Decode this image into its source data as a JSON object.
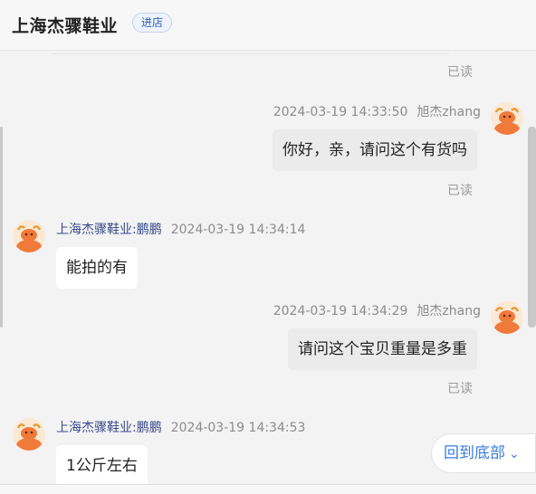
{
  "header": {
    "shop_name": "上海杰骤鞋业",
    "enter_shop": "进店"
  },
  "messages": [
    {
      "read": "已读"
    },
    {
      "time": "2024-03-19 14:33:50",
      "sender": "旭杰zhang",
      "text": "你好，亲，请问这个有货吗",
      "read": "已读"
    },
    {
      "sender": "上海杰骤鞋业:鹏鹏",
      "time": "2024-03-19 14:34:14",
      "text": "能拍的有"
    },
    {
      "time": "2024-03-19 14:34:29",
      "sender": "旭杰zhang",
      "text": "请问这个宝贝重量是多重",
      "read": "已读"
    },
    {
      "sender": "上海杰骤鞋业:鹏鹏",
      "time": "2024-03-19 14:34:53",
      "text": "1公斤左右"
    }
  ],
  "back_to_bottom": {
    "label": "回到底部",
    "icon": "chevron-down-icon"
  },
  "colors": {
    "accent": "#3a7de0",
    "sender": "#3a4a8c",
    "avatar": "#f07a3a"
  }
}
